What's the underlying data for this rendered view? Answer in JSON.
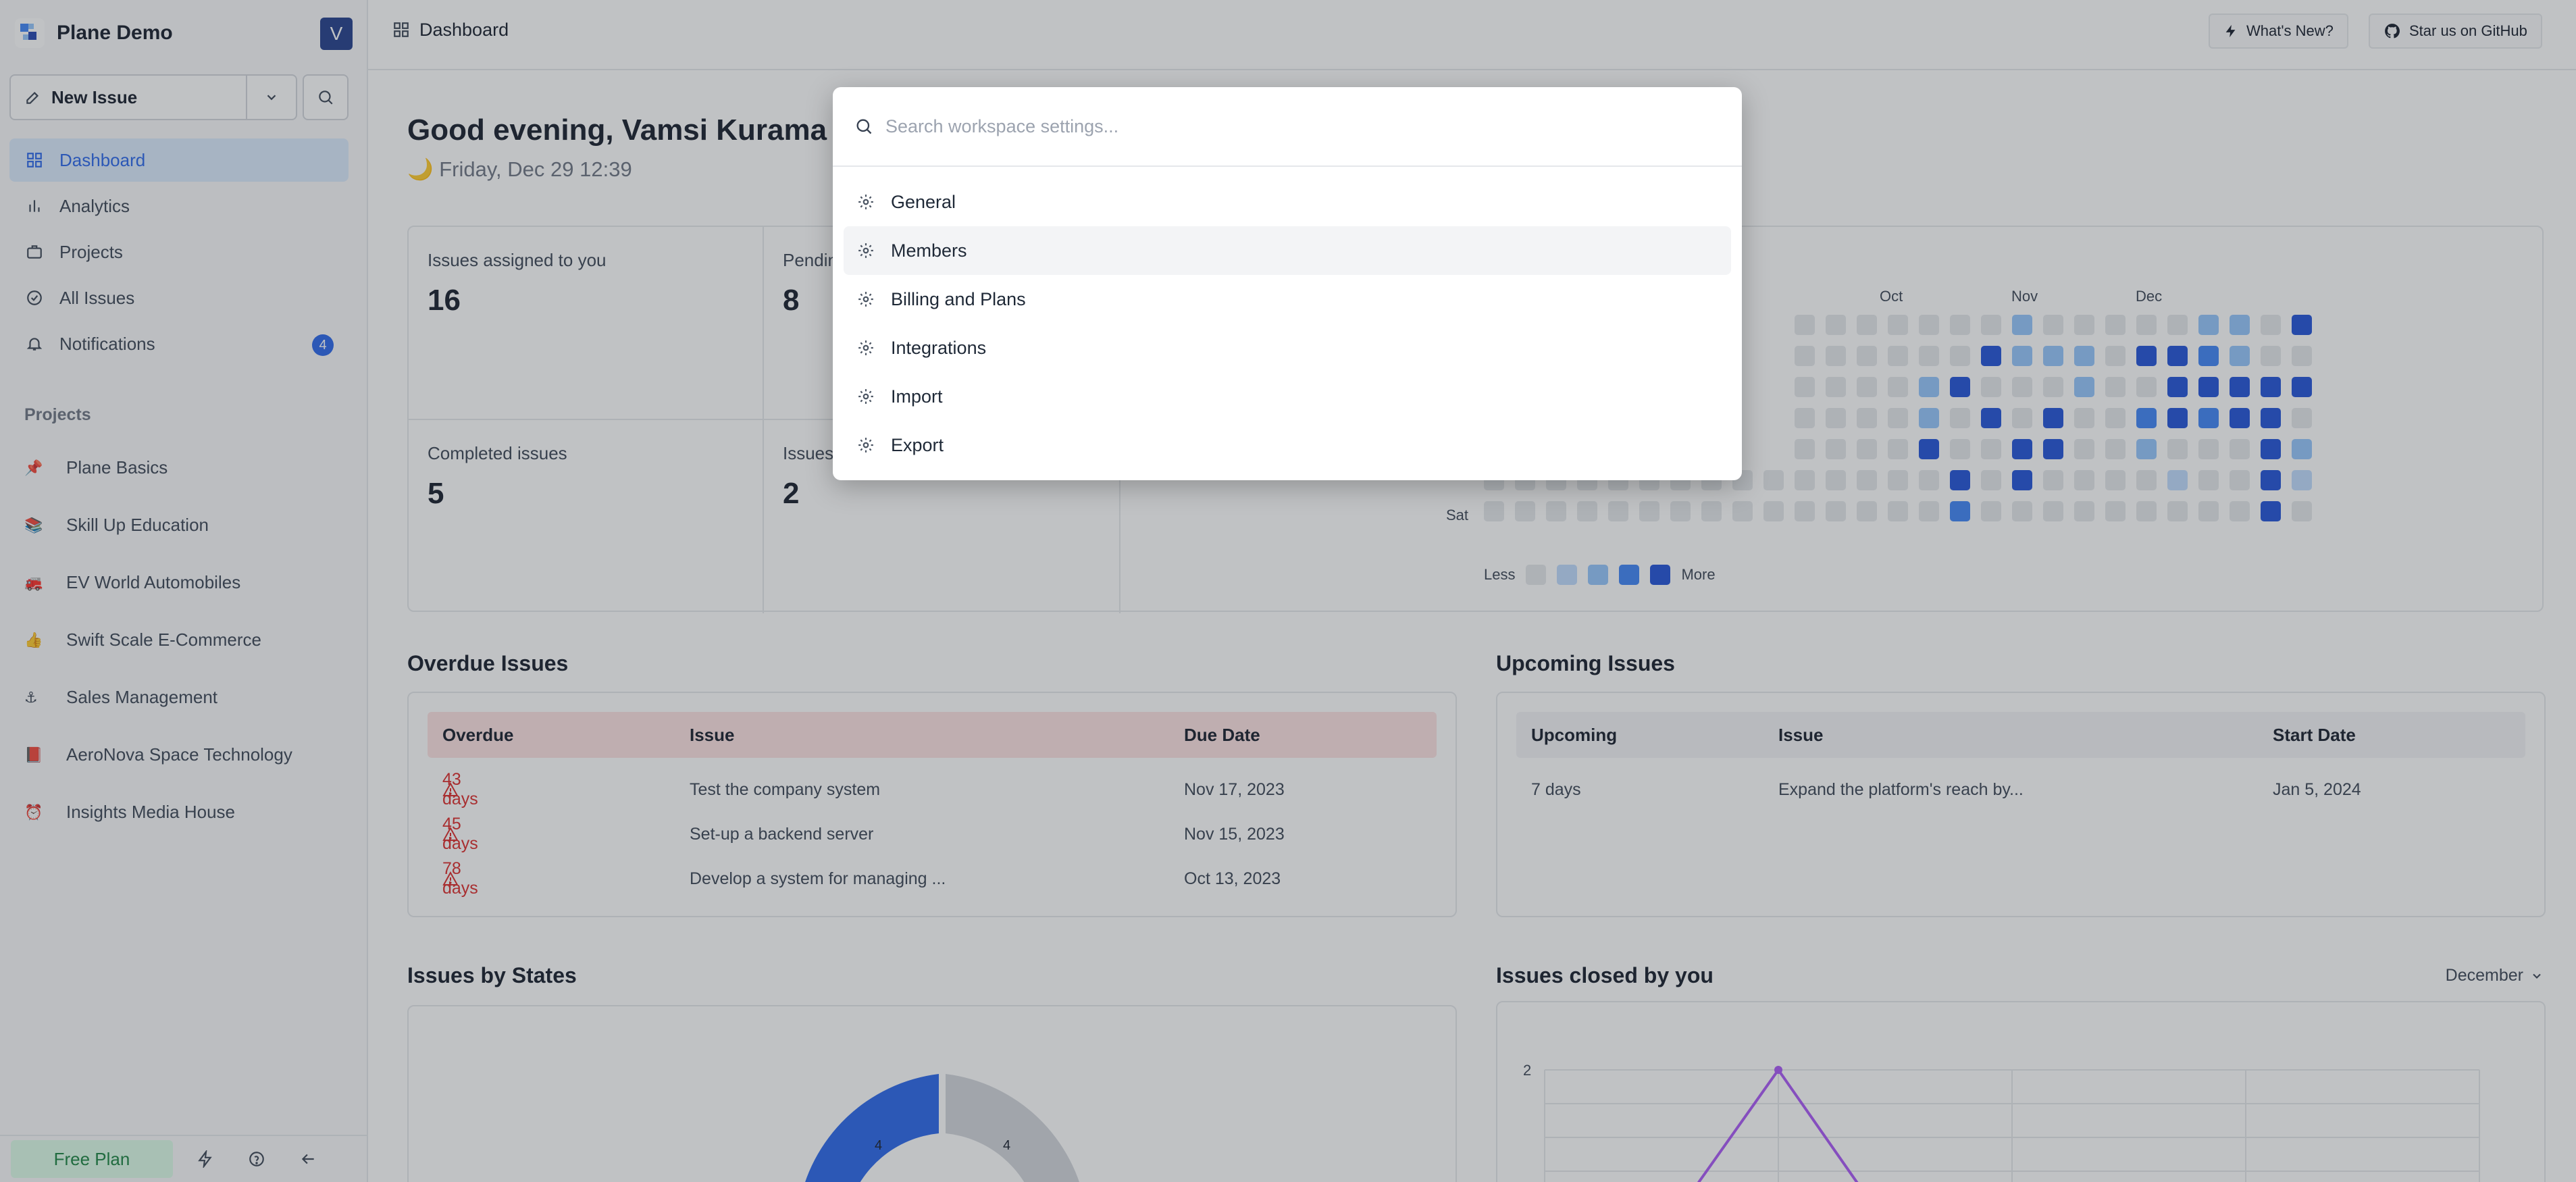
{
  "workspace": {
    "name": "Plane Demo",
    "avatar_letter": "V"
  },
  "sidebar": {
    "new_issue_label": "New Issue",
    "nav": [
      {
        "label": "Dashboard",
        "icon": "grid-icon",
        "active": true
      },
      {
        "label": "Analytics",
        "icon": "bar-chart-icon"
      },
      {
        "label": "Projects",
        "icon": "briefcase-icon"
      },
      {
        "label": "All Issues",
        "icon": "check-circle-icon"
      },
      {
        "label": "Notifications",
        "icon": "bell-icon",
        "badge": "4"
      }
    ],
    "projects_heading": "Projects",
    "projects": [
      {
        "emoji": "📌",
        "label": "Plane Basics"
      },
      {
        "emoji": "📚",
        "label": "Skill Up Education"
      },
      {
        "emoji": "🚒",
        "label": "EV World Automobiles"
      },
      {
        "emoji": "👍",
        "label": "Swift Scale E-Commerce"
      },
      {
        "emoji": "⚓",
        "label": "Sales Management"
      },
      {
        "emoji": "📕",
        "label": "AeroNova Space Technology"
      },
      {
        "emoji": "⏰",
        "label": "Insights Media House"
      }
    ],
    "footer": {
      "plan_label": "Free Plan"
    }
  },
  "topbar": {
    "breadcrumb": "Dashboard",
    "whats_new": "What's New?",
    "github": "Star us on GitHub"
  },
  "main": {
    "greeting": "Good evening, Vamsi Kurama",
    "date": "Friday, Dec 29 12:39",
    "stats": [
      {
        "label": "Issues assigned to you",
        "value": "16"
      },
      {
        "label": "Pendin",
        "value": "8"
      },
      {
        "label": "Completed issues",
        "value": "5"
      },
      {
        "label": "Issues",
        "value": "2"
      }
    ],
    "heatmap": {
      "months": [
        "Oct",
        "Nov",
        "Dec"
      ],
      "day_label": "Sat",
      "legend_less": "Less",
      "legend_more": "More",
      "colors": [
        "#e5e7eb",
        "#bfdbfe",
        "#93c5fd",
        "#3b82f6",
        "#1d4ed8"
      ]
    },
    "overdue": {
      "title": "Overdue Issues",
      "headers": [
        "Overdue",
        "Issue",
        "Due Date"
      ],
      "rows": [
        {
          "days": "43 days",
          "issue": "Test the company system",
          "date": "Nov 17, 2023"
        },
        {
          "days": "45 days",
          "issue": "Set-up a backend server",
          "date": "Nov 15, 2023"
        },
        {
          "days": "78 days",
          "issue": "Develop a system for managing ...",
          "date": "Oct 13, 2023"
        }
      ]
    },
    "upcoming": {
      "title": "Upcoming Issues",
      "headers": [
        "Upcoming",
        "Issue",
        "Start Date"
      ],
      "rows": [
        {
          "days": "7 days",
          "issue": "Expand the platform's reach by...",
          "date": "Jan 5, 2024"
        }
      ]
    },
    "states": {
      "title": "Issues by States",
      "slice_values": [
        "4",
        "4"
      ]
    },
    "closed": {
      "title": "Issues closed by you",
      "month": "December",
      "y_tick": "2"
    }
  },
  "modal": {
    "placeholder": "Search workspace settings...",
    "options": [
      {
        "label": "General"
      },
      {
        "label": "Members",
        "active": true
      },
      {
        "label": "Billing and Plans"
      },
      {
        "label": "Integrations"
      },
      {
        "label": "Import"
      },
      {
        "label": "Export"
      }
    ]
  }
}
